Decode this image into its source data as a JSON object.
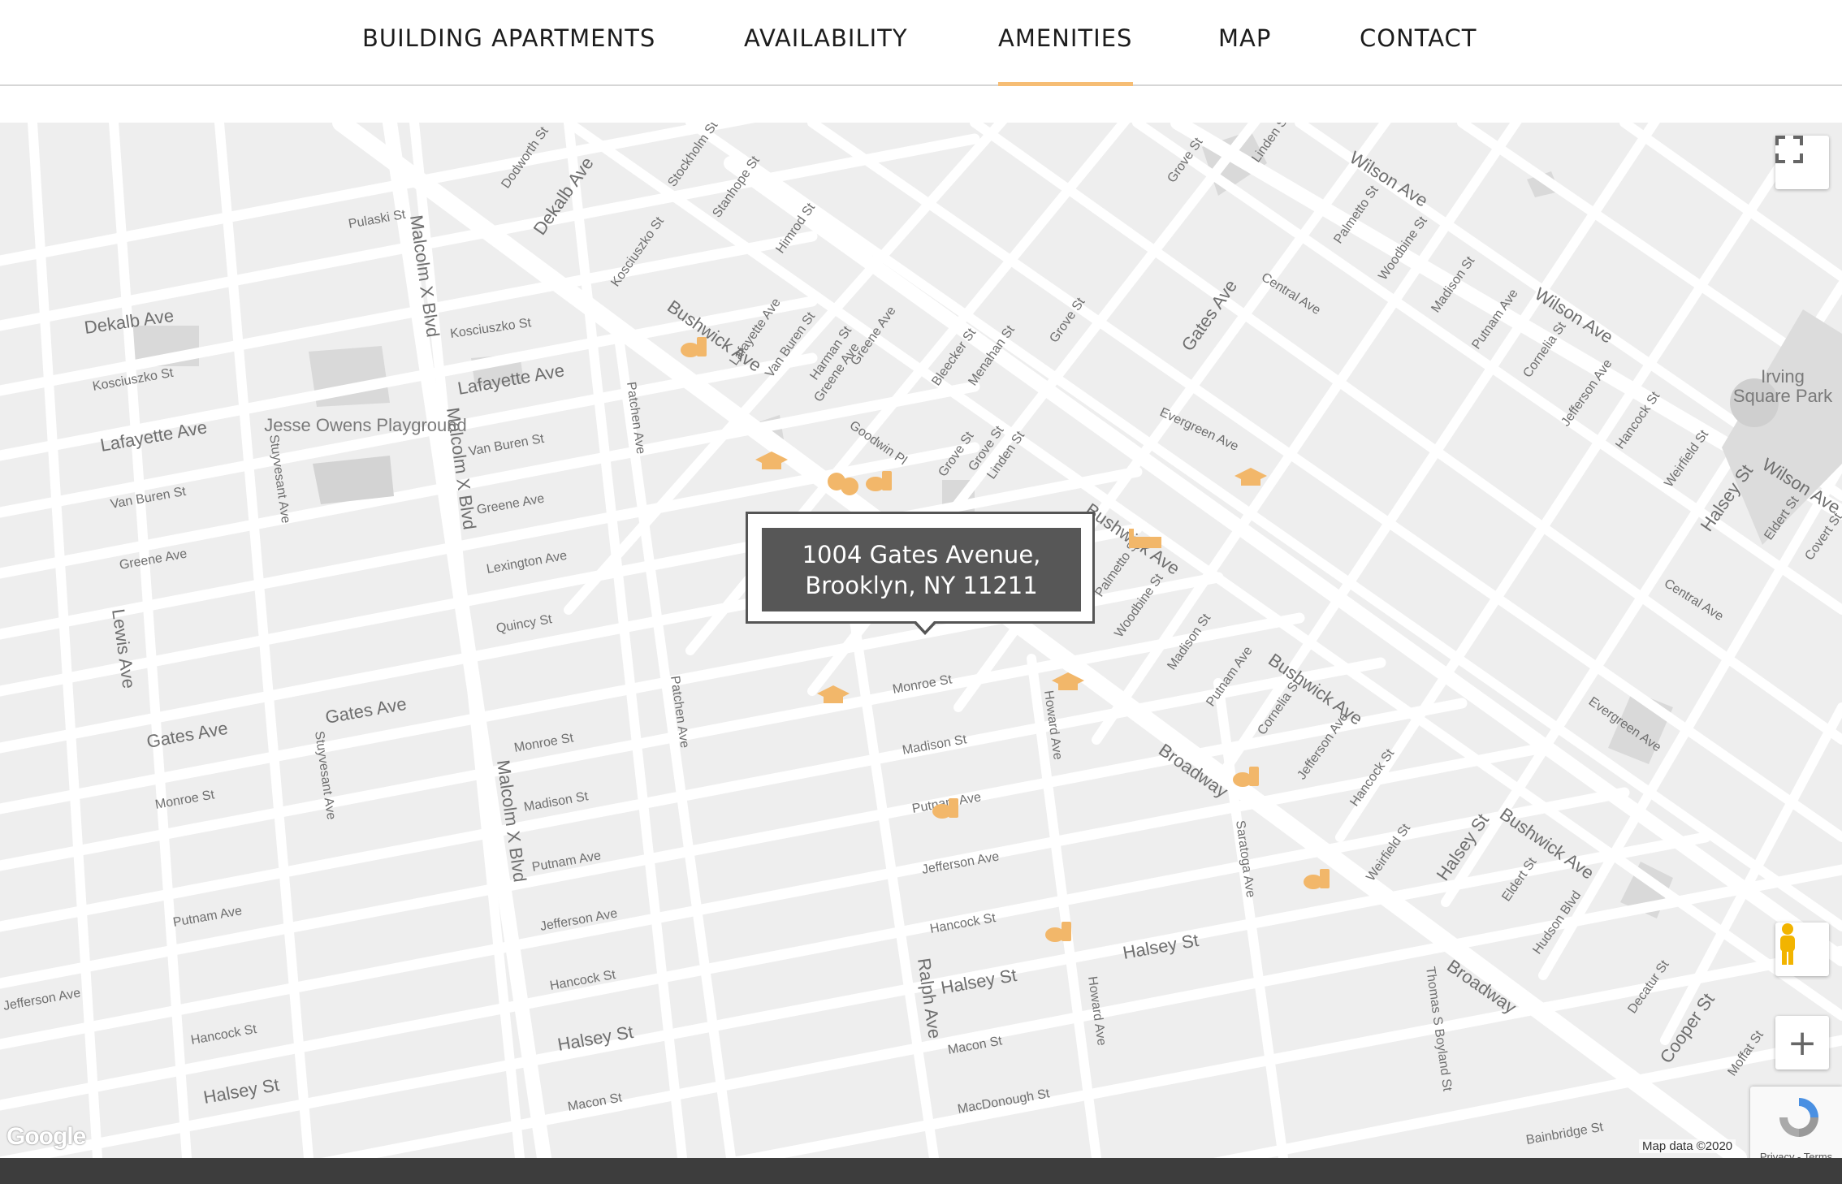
{
  "nav": {
    "items": [
      "BUILDING APARTMENTS",
      "AVAILABILITY",
      "AMENITIES",
      "MAP",
      "CONTACT"
    ],
    "active": "AMENITIES",
    "accent_color": "#f6bd74"
  },
  "infobox": {
    "line1": "1004 Gates Avenue,",
    "line2": "Brooklyn, NY 11211"
  },
  "map": {
    "background_color": "#eeeeee",
    "icon_color": "#f2b76a",
    "streets": [
      "Pulaski St",
      "Malcolm X Blvd",
      "Dekalb Ave",
      "Kosciuszko St",
      "Lafayette Ave",
      "Van Buren St",
      "Greene Ave",
      "Lexington Ave",
      "Quincy St",
      "Gates Ave",
      "Monroe St",
      "Madison St",
      "Putnam Ave",
      "Jefferson Ave",
      "Hancock St",
      "Halsey St",
      "Macon St",
      "MacDonough St",
      "Lewis Ave",
      "Stuyvesant Ave",
      "Patchen Ave",
      "Ralph Ave",
      "Howard Ave",
      "Saratoga Ave",
      "Broadway",
      "Bushwick Ave",
      "Evergreen Ave",
      "Central Ave",
      "Wilson Ave",
      "Grove St",
      "Linden St",
      "Palmetto St",
      "Woodbine St",
      "Cornelia St",
      "Weirfield St",
      "Eldert St",
      "Hudson Blvd",
      "Decatur St",
      "Cooper St",
      "Moffat St",
      "Thomas S Boyland St",
      "Bainbridge St",
      "Menahan St",
      "Bleecker St",
      "Harman St",
      "Himrod St",
      "Stanhope St",
      "Stockholm St",
      "Dodworth St",
      "Goodwin Pl"
    ],
    "pois": [
      "Jesse Owens Playground",
      "Irving Square Park"
    ],
    "attribution": "Map data ©2020",
    "google_logo": "Google"
  },
  "controls": {
    "fullscreen": "fullscreen-icon",
    "pegman": "pegman-icon",
    "zoom_in": "+"
  },
  "recaptcha": {
    "text": "Privacy - Terms"
  }
}
